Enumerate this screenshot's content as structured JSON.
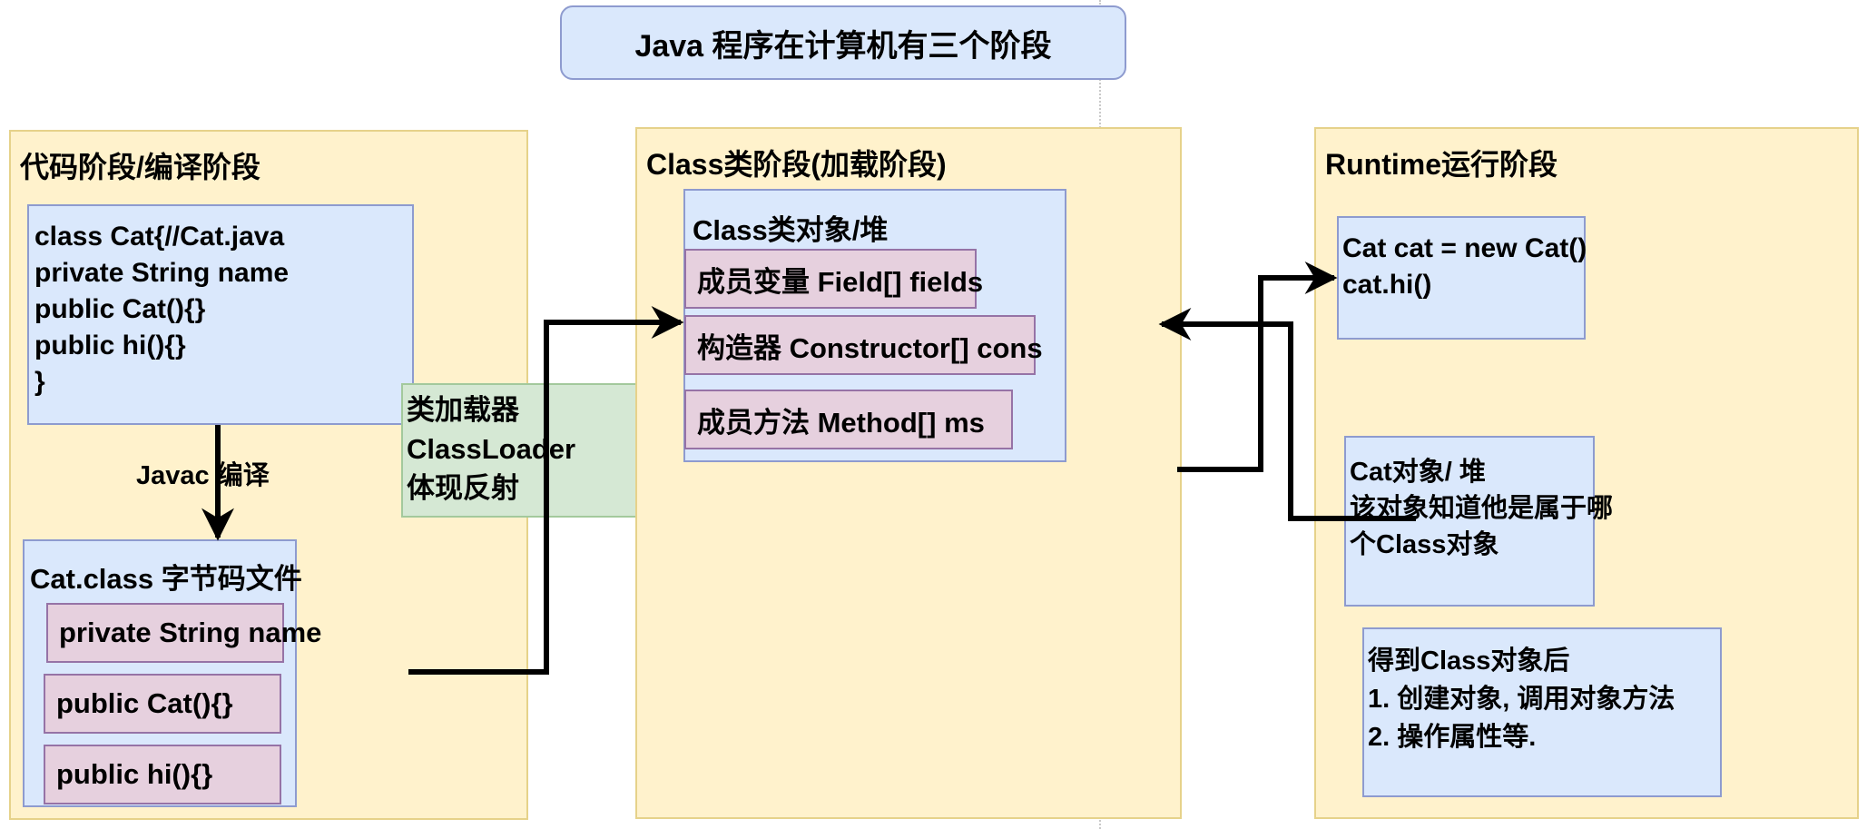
{
  "title": "Java 程序在计算机有三个阶段",
  "stages": {
    "code": {
      "title": "代码阶段/编译阶段",
      "source": {
        "lines": [
          "class Cat{//Cat.java",
          "private String name",
          "public Cat(){}",
          "public hi(){}",
          "}"
        ]
      },
      "compile_label": "Javac 编译",
      "bytecode": {
        "title": "Cat.class 字节码文件",
        "members": [
          "private String name",
          "public Cat(){}",
          "public hi(){}"
        ]
      }
    },
    "classloader": {
      "lines": [
        "类加载器",
        "ClassLoader",
        "体现反射"
      ]
    },
    "class": {
      "title": "Class类阶段(加载阶段)",
      "heap_title": "Class类对象/堆",
      "members": [
        "成员变量 Field[] fields",
        "构造器 Constructor[] cons",
        "成员方法 Method[] ms"
      ]
    },
    "runtime": {
      "title": "Runtime运行阶段",
      "code_lines": [
        "Cat cat = new Cat()",
        "cat.hi()"
      ],
      "object_lines": [
        "Cat对象/ 堆",
        "该对象知道他是属于哪",
        "个Class对象"
      ],
      "after_lines": [
        "得到Class对象后",
        "1. 创建对象, 调用对象方法",
        "2. 操作属性等."
      ]
    }
  },
  "colors": {
    "stage_fill": "#fff2cc",
    "box_fill": "#dae8fc",
    "member_fill": "#e6d0de",
    "loader_fill": "#d5e8d4",
    "arrow": "#000000"
  }
}
